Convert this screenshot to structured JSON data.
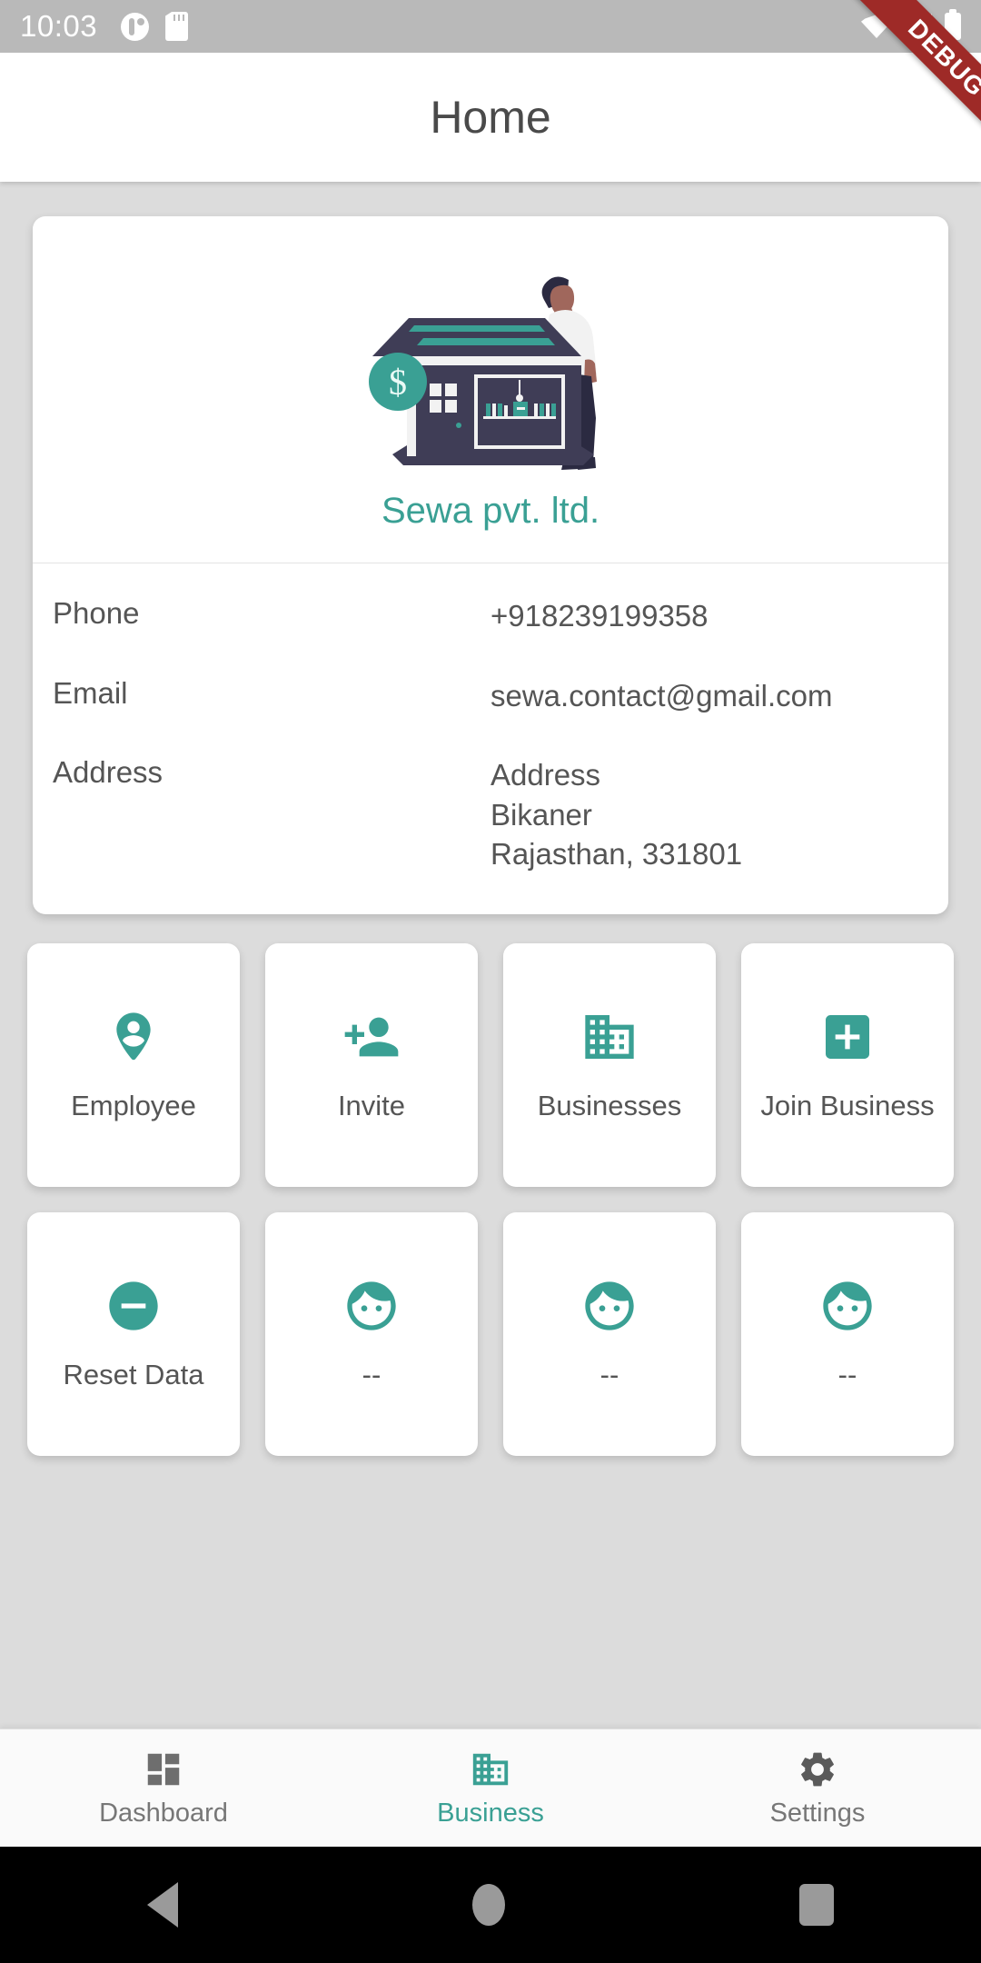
{
  "status_bar": {
    "time": "10:03",
    "left_icons": [
      "notification-circle-icon",
      "sd-card-icon"
    ],
    "right_icons": [
      "wifi-icon",
      "signal-icon",
      "battery-icon"
    ]
  },
  "debug_banner": {
    "label": "DEBUG",
    "color": "#9e2a27"
  },
  "app_bar": {
    "title": "Home"
  },
  "business_card": {
    "illustration": "storefront-illustration",
    "name": "Sewa pvt. ltd.",
    "name_color": "#3aa094",
    "rows": [
      {
        "label": "Phone",
        "value": "+918239199358"
      },
      {
        "label": "Email",
        "value": "sewa.contact@gmail.com"
      },
      {
        "label": "Address",
        "value": "Address\nBikaner\nRajasthan, 331801"
      }
    ]
  },
  "tiles": [
    {
      "label": "Employee",
      "icon": "person-pin-icon"
    },
    {
      "label": "Invite",
      "icon": "person-add-icon"
    },
    {
      "label": "Businesses",
      "icon": "building-icon"
    },
    {
      "label": "Join Business",
      "icon": "add-box-icon"
    },
    {
      "label": "Reset Data",
      "icon": "remove-circle-icon"
    },
    {
      "label": "--",
      "icon": "face-icon"
    },
    {
      "label": "--",
      "icon": "face-icon"
    },
    {
      "label": "--",
      "icon": "face-icon"
    }
  ],
  "bottom_nav": {
    "active_color": "#3aa094",
    "inactive_color": "#777777",
    "items": [
      {
        "label": "Dashboard",
        "icon": "dashboard-icon",
        "active": false
      },
      {
        "label": "Business",
        "icon": "business-icon",
        "active": true
      },
      {
        "label": "Settings",
        "icon": "settings-gear-icon",
        "active": false
      }
    ]
  },
  "android_nav": {
    "buttons": [
      "back-button",
      "home-button",
      "recents-button"
    ]
  },
  "theme": {
    "accent": "#3aa094",
    "page_bg": "#dcdcdc",
    "card_bg": "#ffffff",
    "text": "#555555"
  }
}
